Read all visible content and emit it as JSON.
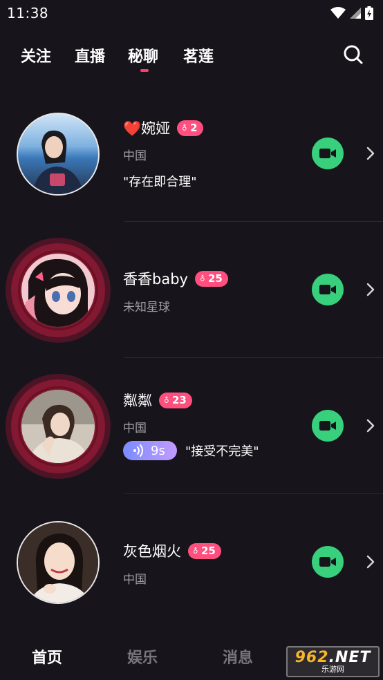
{
  "status_bar": {
    "time": "11:38"
  },
  "top_tabs": [
    {
      "label": "关注",
      "active": false
    },
    {
      "label": "直播",
      "active": false
    },
    {
      "label": "秘聊",
      "active": true
    },
    {
      "label": "茗莲",
      "active": false
    }
  ],
  "accent_color": "#ff3c6e",
  "call_button_color": "#38d07c",
  "users": [
    {
      "name": "❤️婉娅",
      "level": "2",
      "location": "中国",
      "signature": "\"存在即合理\"",
      "live_ring": false
    },
    {
      "name": "香香baby",
      "level": "25",
      "location": "未知星球",
      "signature": "",
      "live_ring": true
    },
    {
      "name": "粼粼",
      "level": "23",
      "location": "中国",
      "voice_duration": "9s",
      "signature": "\"接受不完美\"",
      "live_ring": true
    },
    {
      "name": "灰色烟火",
      "level": "25",
      "location": "中国",
      "signature": "",
      "live_ring": false
    }
  ],
  "bottom_nav": [
    {
      "label": "首页",
      "active": true
    },
    {
      "label": "娱乐",
      "active": false
    },
    {
      "label": "消息",
      "active": false
    }
  ],
  "watermark": {
    "main": "962",
    "suffix": ".NET",
    "sub": "乐游网"
  }
}
